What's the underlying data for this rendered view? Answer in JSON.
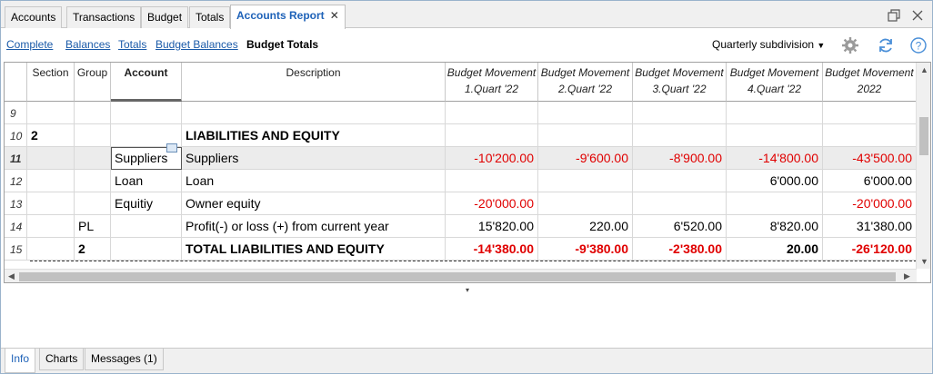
{
  "tabs": [
    {
      "label": "Accounts"
    },
    {
      "label": "Transactions"
    },
    {
      "label": "Budget"
    },
    {
      "label": "Totals"
    },
    {
      "label": "Accounts Report",
      "active": true
    }
  ],
  "toolbar": {
    "links": [
      "Complete",
      "Balances",
      "Totals",
      "Budget Balances",
      "Budget Totals"
    ],
    "active_link": "Budget Totals",
    "subdivision": "Quarterly subdivision"
  },
  "columns": {
    "section": "Section",
    "group": "Group",
    "account": "Account",
    "description": "Description",
    "budget": [
      {
        "line1": "Budget Movement",
        "line2": "1.Quart '22"
      },
      {
        "line1": "Budget Movement",
        "line2": "2.Quart '22"
      },
      {
        "line1": "Budget Movement",
        "line2": "3.Quart '22"
      },
      {
        "line1": "Budget Movement",
        "line2": "4.Quart '22"
      },
      {
        "line1": "Budget Movement",
        "line2": "2022"
      }
    ]
  },
  "rows": [
    {
      "num": "9",
      "section": "",
      "group": "",
      "account": "",
      "description": "",
      "values": [
        "",
        "",
        "",
        "",
        ""
      ]
    },
    {
      "num": "10",
      "section": "2",
      "group": "",
      "account": "",
      "description": "LIABILITIES AND EQUITY",
      "values": [
        "",
        "",
        "",
        "",
        ""
      ]
    },
    {
      "num": "11",
      "section": "",
      "group": "",
      "account": "Suppliers",
      "description": "Suppliers",
      "values": [
        "-10'200.00",
        "-9'600.00",
        "-8'900.00",
        "-14'800.00",
        "-43'500.00"
      ]
    },
    {
      "num": "12",
      "section": "",
      "group": "",
      "account": "Loan",
      "description": "Loan",
      "values": [
        "",
        "",
        "",
        "6'000.00",
        "6'000.00"
      ]
    },
    {
      "num": "13",
      "section": "",
      "group": "",
      "account": "Equitiy",
      "description": "Owner equity",
      "values": [
        "-20'000.00",
        "",
        "",
        "",
        "-20'000.00"
      ]
    },
    {
      "num": "14",
      "section": "",
      "group": "PL",
      "account": "",
      "description": "Profit(-) or loss (+) from current year",
      "values": [
        "15'820.00",
        "220.00",
        "6'520.00",
        "8'820.00",
        "31'380.00"
      ]
    },
    {
      "num": "15",
      "section": "",
      "group": "2",
      "account": "",
      "description": "TOTAL LIABILITIES AND EQUITY",
      "values": [
        "-14'380.00",
        "-9'380.00",
        "-2'380.00",
        "20.00",
        "-26'120.00"
      ]
    }
  ],
  "bottom_tabs": [
    {
      "label": "Info",
      "active": true
    },
    {
      "label": "Charts"
    },
    {
      "label": "Messages (1)"
    }
  ],
  "colors": {
    "accent": "#1e62b8",
    "negative": "#e00000",
    "link": "#1a5aa8"
  }
}
